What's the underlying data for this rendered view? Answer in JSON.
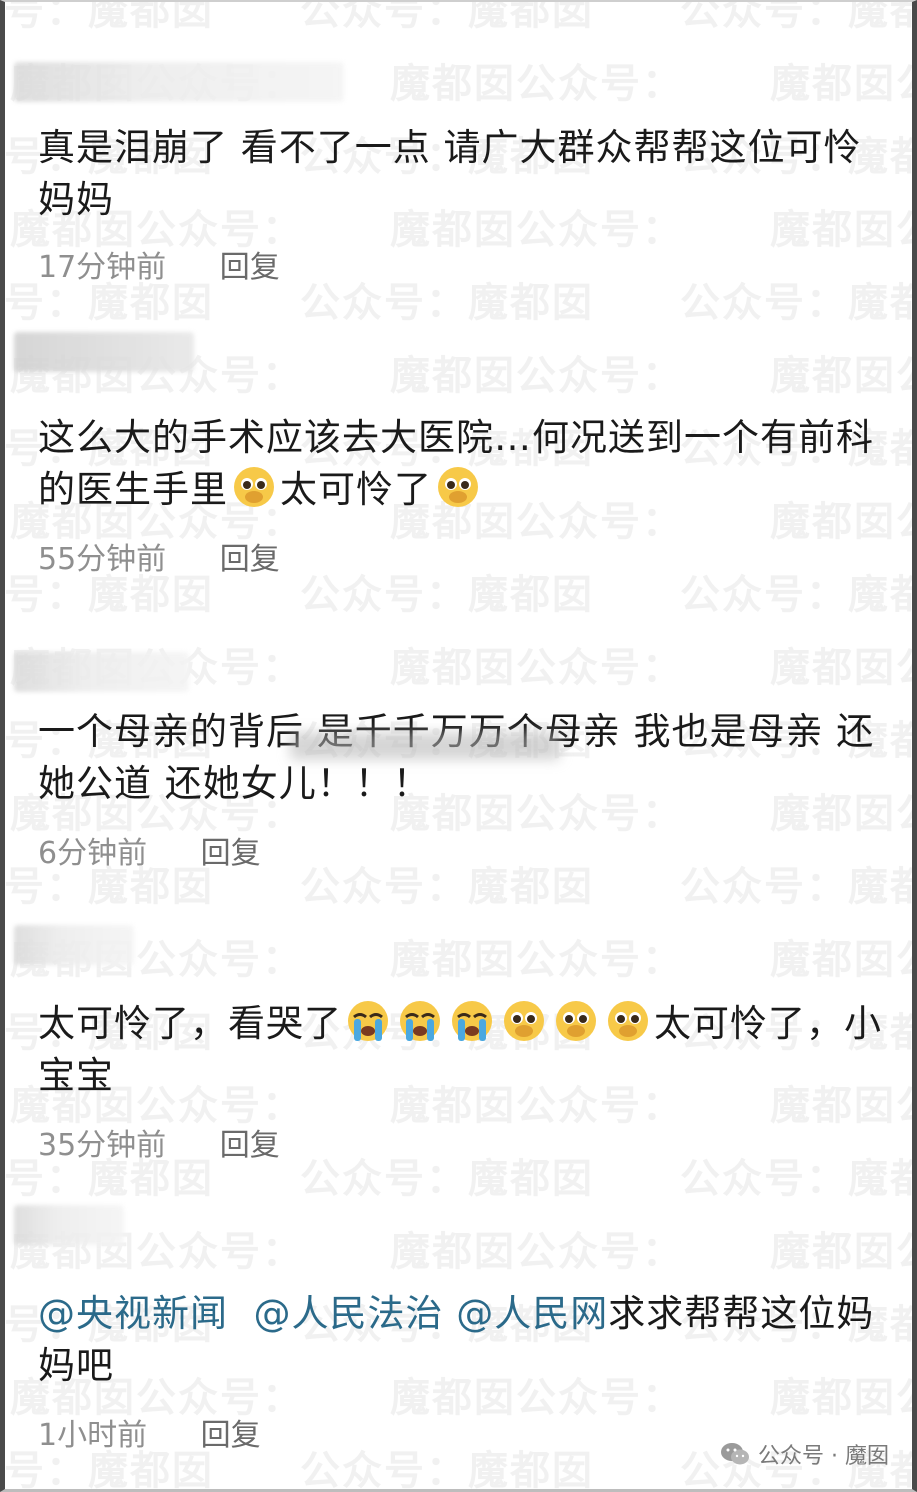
{
  "watermark_text": "魔都囡",
  "watermark_text_b": "公众号：",
  "comments": [
    {
      "text": "真是泪崩了 看不了一点 请广大群众帮帮这位可怜妈妈",
      "time": "17分钟前",
      "reply": "回复"
    },
    {
      "text_a": "这么大的手术应该去大医院…何况送到一个有前科的医生手里",
      "text_b": "太可怜了",
      "time": "55分钟前",
      "reply": "回复"
    },
    {
      "text": "一个母亲的背后 是千千万万个母亲 我也是母亲 还她公道 还她女儿！！！",
      "time": "6分钟前",
      "reply": "回复"
    },
    {
      "text_a": "太可怜了，看哭了",
      "text_b": "太可怜了，小宝宝",
      "time": "35分钟前",
      "reply": "回复"
    },
    {
      "mention_1": "@央视新闻",
      "mention_2": "@人民法治",
      "mention_3": "@人民网",
      "text_tail": "求求帮帮这位妈妈吧",
      "time": "1小时前",
      "reply": "回复"
    }
  ],
  "footer": {
    "label": "公众号 · 魔囡"
  },
  "colors": {
    "mention": "#2b6a8a",
    "meta": "#8f8f8f",
    "emoji_face": "#f7c948",
    "tear": "#4aa8e0"
  }
}
